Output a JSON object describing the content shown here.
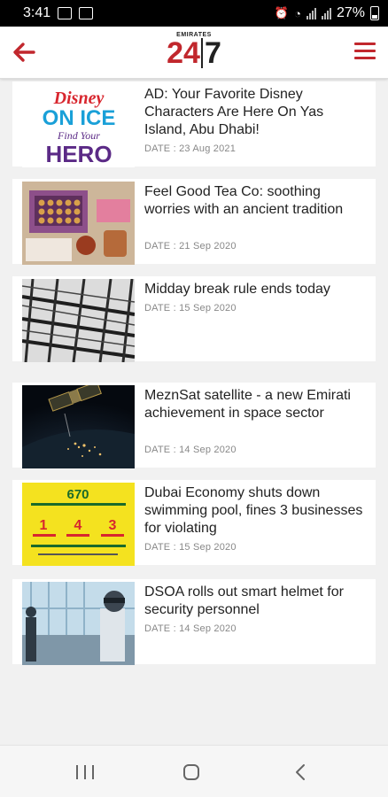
{
  "status": {
    "time": "3:41",
    "battery_percent": "27%"
  },
  "header": {
    "logo_top": "EMIRATES",
    "logo_main_left": "24",
    "logo_main_right": "7",
    "accent": "#c1272d"
  },
  "articles": [
    {
      "title": "AD: Your Favorite Disney Characters Are Here On Yas Island, Abu Dhabi!",
      "date": "DATE : 23 Aug 2021",
      "thumb": "disney-on-ice-image"
    },
    {
      "title": "Feel Good Tea Co: soothing worries with an ancient tradition",
      "date": "DATE : 21 Sep 2020",
      "thumb": "tea-box-image"
    },
    {
      "title": "Midday break rule ends today",
      "date": "DATE : 15 Sep 2020",
      "thumb": "scaffolding-image"
    },
    {
      "title": "MeznSat satellite - a new Emirati achievement in space sector",
      "date": "DATE : 14 Sep 2020",
      "thumb": "satellite-image"
    },
    {
      "title": "Dubai Economy shuts down swimming pool, fines 3 businesses for violating",
      "date": "DATE : 15 Sep 2020",
      "thumb": "notice-poster-image"
    },
    {
      "title": "DSOA rolls out smart helmet for security personnel",
      "date": "DATE : 14 Sep 2020",
      "thumb": "smart-helmet-image"
    }
  ],
  "thumb_text": {
    "disney_brand": "Disney",
    "disney_show": "ON ICE",
    "disney_sub": "Find Your",
    "disney_hero": "HERO",
    "poster_number": "670",
    "poster_n1": "1",
    "poster_n2": "4",
    "poster_n3": "3"
  }
}
